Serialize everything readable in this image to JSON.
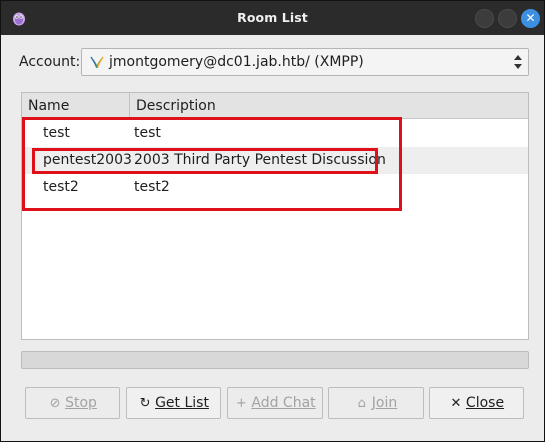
{
  "window": {
    "title": "Room List"
  },
  "account": {
    "label": "Account:",
    "value": "jmontgomery@dc01.jab.htb/ (XMPP)"
  },
  "table": {
    "columns": [
      "Name",
      "Description"
    ],
    "rows": [
      {
        "name": "test",
        "description": "test"
      },
      {
        "name": "pentest2003",
        "description": "2003 Third Party Pentest Discussion"
      },
      {
        "name": "test2",
        "description": "test2"
      }
    ]
  },
  "progress": {
    "fraction": 0
  },
  "buttons": {
    "stop": "Stop",
    "get_list": "Get List",
    "add_chat": "Add Chat",
    "join": "Join",
    "close": "Close"
  },
  "colors": {
    "highlight": "#e0101a",
    "close_accent": "#3d8fe0"
  },
  "icons": {
    "app": "pidgin-icon",
    "protocol": "xmpp-icon"
  }
}
